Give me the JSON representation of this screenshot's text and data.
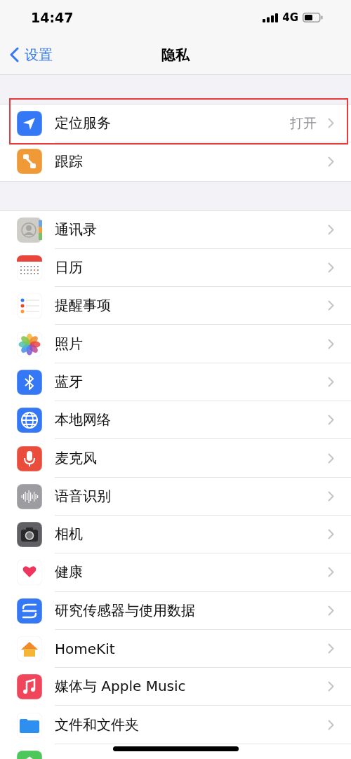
{
  "status_bar": {
    "time": "14:47",
    "network": "4G"
  },
  "nav": {
    "back": "设置",
    "title": "隐私"
  },
  "groups": [
    {
      "items": [
        {
          "label": "定位服务",
          "value": "打开",
          "highlighted": true
        },
        {
          "label": "跟踪",
          "highlighted": false
        }
      ]
    },
    {
      "items": [
        {
          "label": "通讯录"
        },
        {
          "label": "日历"
        },
        {
          "label": "提醒事项"
        },
        {
          "label": "照片"
        },
        {
          "label": "蓝牙"
        },
        {
          "label": "本地网络"
        },
        {
          "label": "麦克风"
        },
        {
          "label": "语音识别"
        },
        {
          "label": "相机"
        },
        {
          "label": "健康"
        },
        {
          "label": "研究传感器与使用数据"
        },
        {
          "label": "HomeKit"
        },
        {
          "label": "媒体与 Apple Music"
        },
        {
          "label": "文件和文件夹"
        },
        {
          "kind": "cut"
        }
      ]
    }
  ]
}
